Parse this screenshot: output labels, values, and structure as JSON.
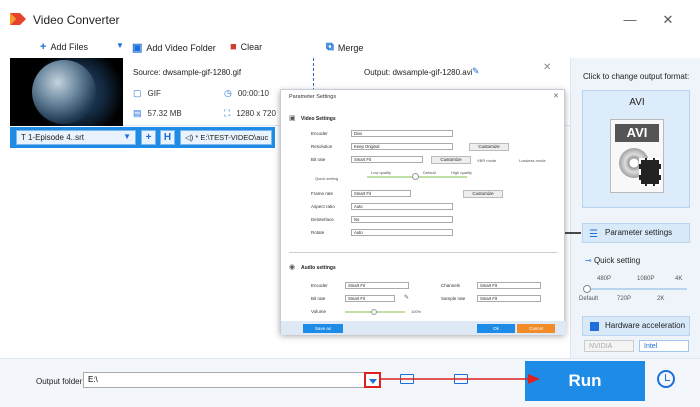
{
  "app": {
    "title": "Video Converter"
  },
  "toolbar": {
    "add_files": "Add Files",
    "add_video_folder": "Add Video Folder",
    "clear": "Clear",
    "merge": "Merge"
  },
  "file": {
    "source": "Source: dwsample-gif-1280.gif",
    "format": "GIF",
    "duration": "00:00:10",
    "size": "57.32 MB",
    "resolution": "1280 x 720",
    "output": "Output: dwsample-gif-1280.avi"
  },
  "subtitle": {
    "selected": "1-Episode 4..srt",
    "audio": "E:\\TEST-VIDEO\\auc"
  },
  "right_panel": {
    "title": "Click to change output format:",
    "format": "AVI",
    "icon_label": "AVI",
    "parameter_settings": "Parameter settings",
    "quick_setting": "Quick setting",
    "quality_top": [
      "480P",
      "1080P",
      "4K"
    ],
    "quality_bottom": [
      "Default",
      "720P",
      "2K"
    ],
    "quality_level": 0,
    "hardware_acceleration": "Hardware acceleration",
    "nvidia": "NVIDIA",
    "intel": "Intel"
  },
  "bottom": {
    "output_folder_label": "Output folder:",
    "output_folder_value": "E:\\",
    "run": "Run"
  },
  "dialog": {
    "title": "Parameter Settings",
    "video_settings": "Video Settings",
    "encoder_label": "Encoder",
    "encoder_value": "Divx",
    "resolution_label": "Resolution",
    "resolution_value": "Keep Original",
    "bitrate_label": "Bit rate",
    "bitrate_value": "Smart Fit",
    "customize": "Customize",
    "vbr_mode": "VBR mode",
    "lossless_mode": "Lossless mode",
    "low_quality": "Low quality",
    "default": "Default",
    "high_quality": "High quality",
    "quick_setting": "Quick setting",
    "frame_rate_label": "Frame rate",
    "frame_rate_value": "Smart Fit",
    "aspect_ratio_label": "Aspect ratio",
    "aspect_ratio_value": "Auto",
    "deinterlace_label": "Deinterlace",
    "deinterlace_value": "No",
    "rotate_label": "Rotate",
    "rotate_value": "Auto",
    "audio_settings": "Audio settings",
    "a_encoder_label": "Encoder",
    "a_encoder_value": "Smart Fit",
    "channels_label": "Channels",
    "channels_value": "Smart Fit",
    "a_bitrate_label": "Bit rate",
    "a_bitrate_value": "Smart Fit",
    "sample_rate_label": "Sample rate",
    "sample_rate_value": "Smart Fit",
    "volume_label": "Volume",
    "volume_value": "100%",
    "save_as": "Save as",
    "ok": "Ok",
    "cancel": "Cancel"
  },
  "colors": {
    "accent": "#1e8ce6",
    "highlight_red": "#e02020",
    "cancel": "#f28c28"
  }
}
